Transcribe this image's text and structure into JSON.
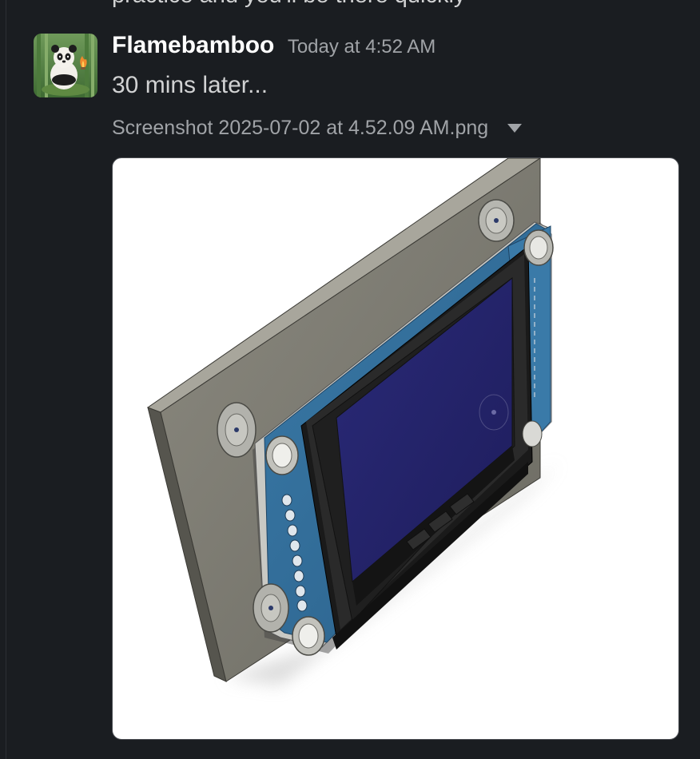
{
  "previous_message": {
    "text": "practice and you'll be there quickly"
  },
  "message": {
    "author": "Flamebamboo",
    "timestamp": "Today at 4:52 AM",
    "text": "30 mins later...",
    "attachment": {
      "filename": "Screenshot 2025-07-02 at 4.52.09 AM.png",
      "menu_icon": "caret-down-icon",
      "alt": "3D CAD render of a display module mounted on a grey plate"
    }
  },
  "colors": {
    "background": "#1a1d21",
    "text_primary": "#ffffff",
    "text_body": "#d1d2d3",
    "text_muted": "#a0a3a7",
    "pcb_blue": "#2e6b97",
    "screen_navy": "#232266"
  }
}
